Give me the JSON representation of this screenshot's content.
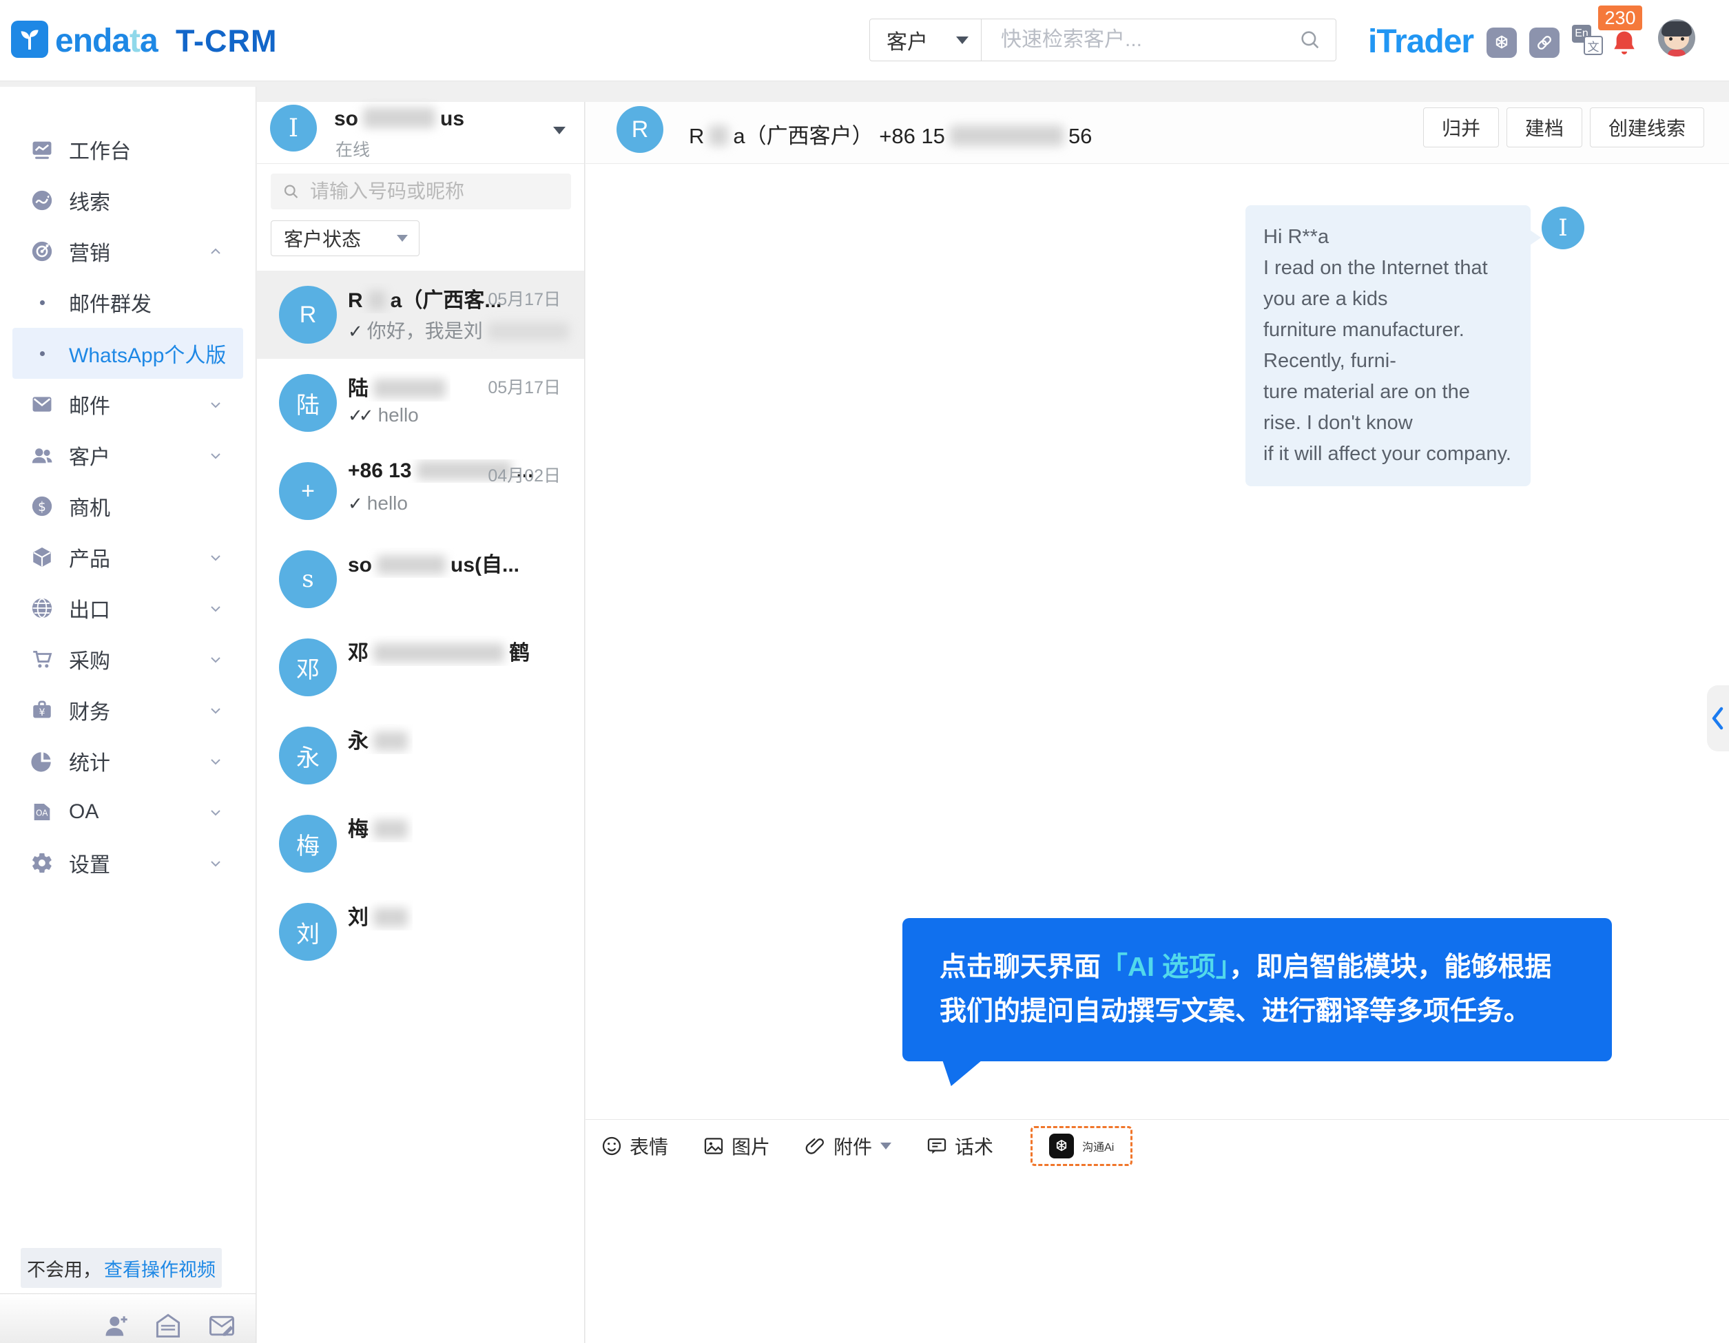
{
  "header": {
    "logo": {
      "brand_pre": "enda",
      "brand_cyan": "t",
      "brand_end": "a",
      "product": "T-CRM"
    },
    "search": {
      "category": "客户",
      "placeholder": "快速检索客户..."
    },
    "right": {
      "trader": "iTrader",
      "notification_count": "230"
    }
  },
  "icons": [
    "sprout-logo-icon",
    "search-icon",
    "chatgpt-icon",
    "link-icon",
    "translate-icon",
    "bell-icon",
    "avatar",
    "magnifier-icon",
    "emoji-icon",
    "image-icon",
    "paperclip-icon",
    "script-icon",
    "openai-icon",
    "collapse-chevron-icon",
    "add-contact-icon",
    "open-mail-icon",
    "compose-mail-icon"
  ],
  "colors": {
    "accent_blue": "#1E88E5",
    "avatar_blue": "#58B0E3",
    "callout_blue": "#1070EE",
    "callout_cyan": "#52D9EB",
    "badge_orange": "#F5793B",
    "ai_dashed_orange": "#F0762B"
  },
  "sidebar": {
    "items": [
      {
        "label": "工作台",
        "icon": "workbench"
      },
      {
        "label": "线索",
        "icon": "leads"
      },
      {
        "label": "营销",
        "icon": "marketing",
        "chevron": "up"
      },
      {
        "label": "邮件群发",
        "icon": "dot",
        "sub": true
      },
      {
        "label": "WhatsApp个人版",
        "icon": "dot",
        "sub": true,
        "active": true
      },
      {
        "label": "邮件",
        "icon": "mail",
        "chevron": "down"
      },
      {
        "label": "客户",
        "icon": "customers",
        "chevron": "down"
      },
      {
        "label": "商机",
        "icon": "opportunity"
      },
      {
        "label": "产品",
        "icon": "product",
        "chevron": "down"
      },
      {
        "label": "出口",
        "icon": "export",
        "chevron": "down"
      },
      {
        "label": "采购",
        "icon": "purchase",
        "chevron": "down"
      },
      {
        "label": "财务",
        "icon": "finance",
        "chevron": "down"
      },
      {
        "label": "统计",
        "icon": "stats",
        "chevron": "down"
      },
      {
        "label": "OA",
        "icon": "oa",
        "chevron": "down"
      },
      {
        "label": "设置",
        "icon": "settings",
        "chevron": "down"
      }
    ],
    "help": {
      "text": "不会用，",
      "link": "查看操作视频"
    }
  },
  "chat_list": {
    "user": {
      "avatar": "I",
      "name_segments": [
        {
          "t": "so"
        },
        {
          "b": 105
        },
        {
          "t": "us"
        }
      ],
      "status": "在线"
    },
    "search_placeholder": "请输入号码或昵称",
    "filter_label": "客户状态",
    "items": [
      {
        "avatar": "R",
        "selected": true,
        "name": [
          {
            "t": "R"
          },
          {
            "b": 26
          },
          {
            "t": "a（广西客..."
          }
        ],
        "date": "05月17日",
        "check": "single",
        "msg": [
          {
            "t": "你好，我是刘"
          },
          {
            "b": 118
          }
        ]
      },
      {
        "avatar": "陆",
        "name": [
          {
            "t": "陆"
          },
          {
            "b": 105
          }
        ],
        "date": "05月17日",
        "check": "double",
        "msg": [
          {
            "t": "hello"
          }
        ]
      },
      {
        "avatar": "+",
        "name": [
          {
            "t": "+86 13"
          },
          {
            "b": 138
          },
          {
            "t": "..."
          }
        ],
        "date": "04月02日",
        "check": "single",
        "msg": [
          {
            "t": "hello"
          }
        ]
      },
      {
        "avatar": "s",
        "name": [
          {
            "t": "so"
          },
          {
            "b": 100
          },
          {
            "t": "us(自..."
          }
        ]
      },
      {
        "avatar": "邓",
        "name": [
          {
            "t": "邓"
          },
          {
            "b": 190
          },
          {
            "t": "鹤"
          }
        ]
      },
      {
        "avatar": "永",
        "name": [
          {
            "t": "永"
          },
          {
            "b": 50
          }
        ]
      },
      {
        "avatar": "梅",
        "name": [
          {
            "t": "梅"
          },
          {
            "b": 50
          }
        ]
      },
      {
        "avatar": "刘",
        "name": [
          {
            "t": "刘"
          },
          {
            "b": 50
          }
        ]
      }
    ]
  },
  "chat": {
    "header": {
      "avatar": "R",
      "name_segments": [
        {
          "t": "R"
        },
        {
          "b": 28
        },
        {
          "t": "a（广西客户） +86 15"
        },
        {
          "b": 165
        },
        {
          "t": "56"
        }
      ],
      "buttons": [
        "归并",
        "建档",
        "创建线索"
      ]
    },
    "message": {
      "avatar": "I",
      "lines": [
        "Hi R**a",
        "I read on the Internet that you are a kids",
        "furniture manufacturer. Recently, furni-",
        "ture material are on the rise. I don't know",
        "if it will affect your company."
      ]
    },
    "callout": {
      "pre": "点击聊天界面",
      "highlight": "「AI 选项」",
      "post": "，即启智能模块，能够根据我们的提问自动撰写文案、进行翻译等多项任务。"
    },
    "toolbar": {
      "emoji": "表情",
      "image": "图片",
      "attachment": "附件",
      "script": "话术",
      "ai": "沟通Ai"
    }
  }
}
